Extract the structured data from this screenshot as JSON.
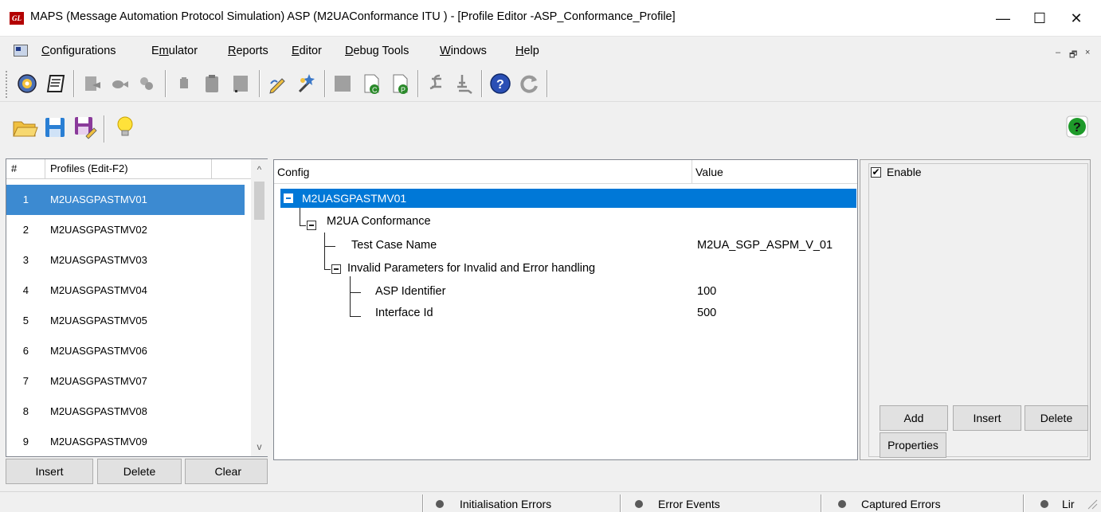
{
  "window": {
    "logo_text": "GL",
    "title": "MAPS (Message Automation Protocol Simulation) ASP (M2UAConformance ITU ) - [Profile Editor -ASP_Conformance_Profile]",
    "minimize_glyph": "—",
    "maximize_glyph": "☐",
    "close_glyph": "✕"
  },
  "menu": {
    "items": [
      {
        "underline": "C",
        "rest": "onfigurations"
      },
      {
        "pre": "E",
        "underline": "m",
        "rest": "ulator"
      },
      {
        "underline": "R",
        "rest": "eports"
      },
      {
        "pre": "",
        "underline": "E",
        "rest": "ditor"
      },
      {
        "underline": "D",
        "rest": "ebug Tools"
      },
      {
        "underline": "W",
        "rest": "indows"
      },
      {
        "underline": "H",
        "rest": "elp"
      }
    ],
    "mdi_minimize": "–",
    "mdi_restore": "🗗",
    "mdi_close": "×"
  },
  "toolbar1": {
    "icons": [
      "configure-icon",
      "script-icon",
      "export-icon",
      "import-icon",
      "transfer-icon",
      "stop-icon",
      "clipboard-icon",
      "blank-icon",
      "edit-pencil-icon",
      "wizard-icon",
      "blank2-icon",
      "compile-c-icon",
      "compile-p-icon",
      "trace-icon",
      "filter-icon",
      "help-circle-icon",
      "refresh-icon"
    ]
  },
  "toolbar2": {
    "icons": [
      "open-folder-icon",
      "save-icon",
      "save-as-icon",
      "lightbulb-icon",
      "help-green-icon"
    ],
    "help_glyph": "?"
  },
  "profiles": {
    "header_num": "#",
    "header_name": "Profiles (Edit-F2)",
    "rows": [
      {
        "num": "1",
        "name": "M2UASGPASTMV01"
      },
      {
        "num": "2",
        "name": "M2UASGPASTMV02"
      },
      {
        "num": "3",
        "name": "M2UASGPASTMV03"
      },
      {
        "num": "4",
        "name": "M2UASGPASTMV04"
      },
      {
        "num": "5",
        "name": "M2UASGPASTMV05"
      },
      {
        "num": "6",
        "name": "M2UASGPASTMV06"
      },
      {
        "num": "7",
        "name": "M2UASGPASTMV07"
      },
      {
        "num": "8",
        "name": "M2UASGPASTMV08"
      },
      {
        "num": "9",
        "name": "M2UASGPASTMV09"
      }
    ],
    "scroll_up": "^",
    "scroll_down": "v",
    "buttons": {
      "insert": "Insert",
      "delete": "Delete",
      "clear": "Clear"
    }
  },
  "tree": {
    "col_config": "Config",
    "col_value": "Value",
    "root": "M2UASGPASTMV01",
    "group1": "M2UA Conformance",
    "test_case_label": "Test Case Name",
    "test_case_value": "M2UA_SGP_ASPM_V_01",
    "group2": "Invalid Parameters for Invalid  and Error handling",
    "asp_id_label": "ASP Identifier",
    "asp_id_value": "100",
    "interface_label": "Interface Id",
    "interface_value": "500"
  },
  "right_panel": {
    "enable_label": "Enable",
    "enable_checked": "✔",
    "add": "Add",
    "insert": "Insert",
    "delete": "Delete",
    "properties": "Properties"
  },
  "status": {
    "items": [
      "Initialisation Errors",
      "Error Events",
      "Captured Errors",
      "Lir"
    ]
  }
}
